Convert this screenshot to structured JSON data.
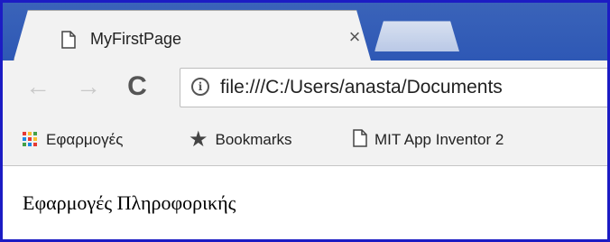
{
  "tab": {
    "title": "MyFirstPage",
    "close_glyph": "×",
    "icon": "file-icon"
  },
  "toolbar": {
    "back_glyph": "←",
    "forward_glyph": "→",
    "reload_glyph": "C",
    "info_glyph": "i",
    "url": "file:///C:/Users/anasta/Documents"
  },
  "bookmarks": {
    "items": [
      {
        "label": "Εφαρμογές",
        "icon": "apps-grid-icon"
      },
      {
        "label": "Bookmarks",
        "icon": "star-icon"
      },
      {
        "label": "MIT App Inventor 2",
        "icon": "file-icon"
      }
    ]
  },
  "page": {
    "heading": "Εφαρμογές Πληροφορικής"
  },
  "colors": {
    "tabstrip": "#2e58b5",
    "frame_border": "#1c1cc4",
    "toolbar": "#f2f2f2",
    "apps_grid": [
      "#e53935",
      "#fbc02d",
      "#43a047",
      "#1e88e5",
      "#e53935",
      "#fbc02d",
      "#43a047",
      "#1e88e5",
      "#e53935"
    ]
  }
}
